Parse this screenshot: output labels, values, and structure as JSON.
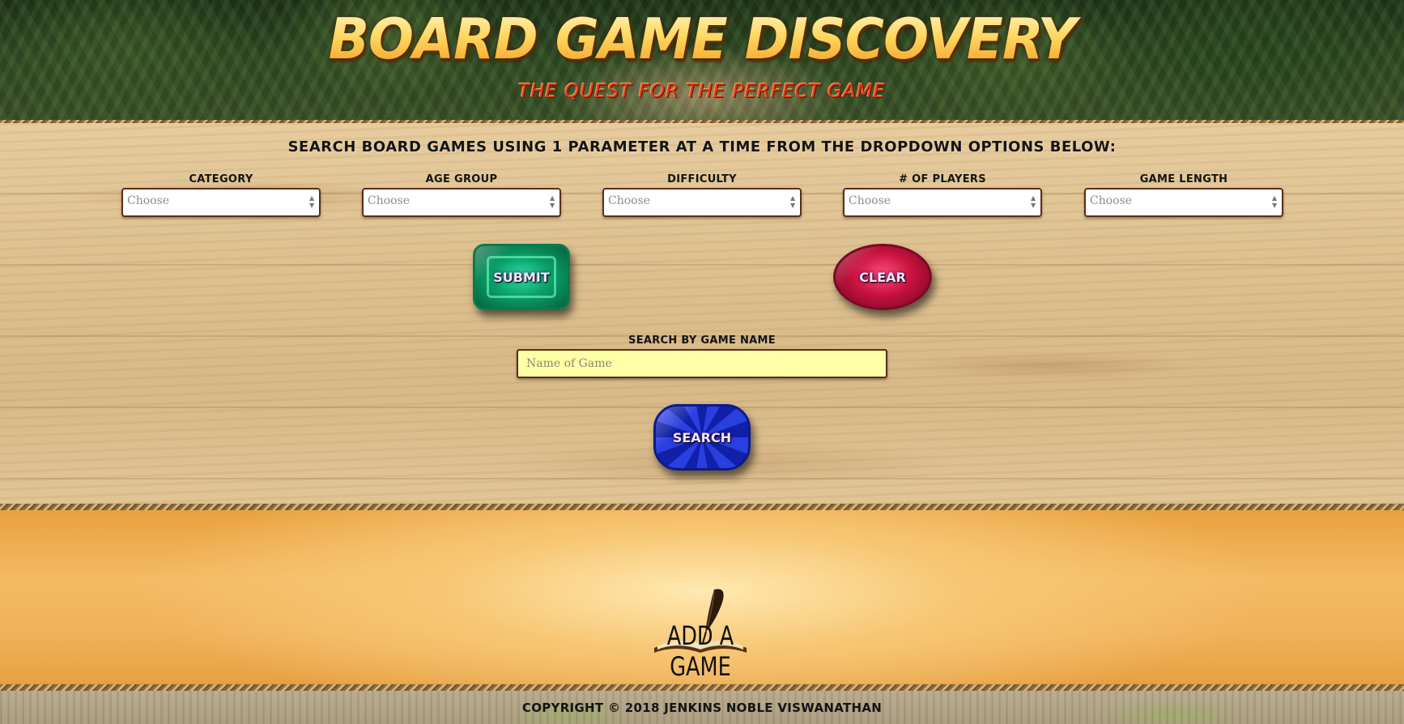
{
  "header": {
    "title": "BOARD GAME DISCOVERY",
    "subtitle": "THE QUEST FOR THE PERFECT GAME"
  },
  "search": {
    "instructions": "SEARCH BOARD GAMES USING 1 PARAMETER AT A TIME FROM THE DROPDOWN OPTIONS BELOW:",
    "filters": [
      {
        "label": "CATEGORY",
        "value": "Choose"
      },
      {
        "label": "AGE GROUP",
        "value": "Choose"
      },
      {
        "label": "DIFFICULTY",
        "value": "Choose"
      },
      {
        "label": "# OF PLAYERS",
        "value": "Choose"
      },
      {
        "label": "GAME LENGTH",
        "value": "Choose"
      }
    ],
    "submit_label": "SUBMIT",
    "clear_label": "CLEAR",
    "name_label": "SEARCH BY GAME NAME",
    "name_placeholder": "Name of Game",
    "search_label": "SEARCH"
  },
  "add_game": {
    "label": "ADD A GAME",
    "icon": "quill-book-icon"
  },
  "footer": {
    "copyright": "COPYRIGHT © 2018 JENKINS NOBLE VISWANATHAN"
  },
  "colors": {
    "title_gold": "#ffd45a",
    "subtitle_red": "#e23b1a",
    "emerald": "#0aa06a",
    "ruby": "#c8123e",
    "sapphire": "#1a2ec8",
    "input_yellow": "#ffffa8",
    "border_brown": "#5b2d1b"
  }
}
